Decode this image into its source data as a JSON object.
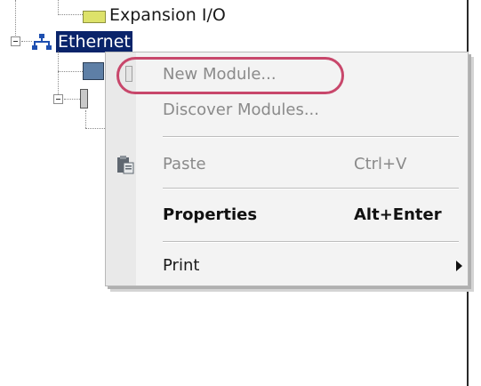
{
  "tree": {
    "items": [
      {
        "label": "Expansion I/O"
      },
      {
        "label": "Ethernet"
      }
    ]
  },
  "context_menu": {
    "items": [
      {
        "label": "New Module...",
        "enabled": false,
        "highlighted": true
      },
      {
        "label": "Discover Modules...",
        "enabled": false
      },
      {
        "label": "Paste",
        "accelerator": "Ctrl+V",
        "enabled": false,
        "icon": "clipboard-icon"
      },
      {
        "label": "Properties",
        "accelerator": "Alt+Enter",
        "bold": true
      },
      {
        "label": "Print",
        "has_submenu": true
      }
    ]
  },
  "colors": {
    "selection": "#0a246a",
    "highlight_oval": "#c8476b",
    "menu_background": "#f3f3f3",
    "disabled_text": "#8a8a8a"
  }
}
